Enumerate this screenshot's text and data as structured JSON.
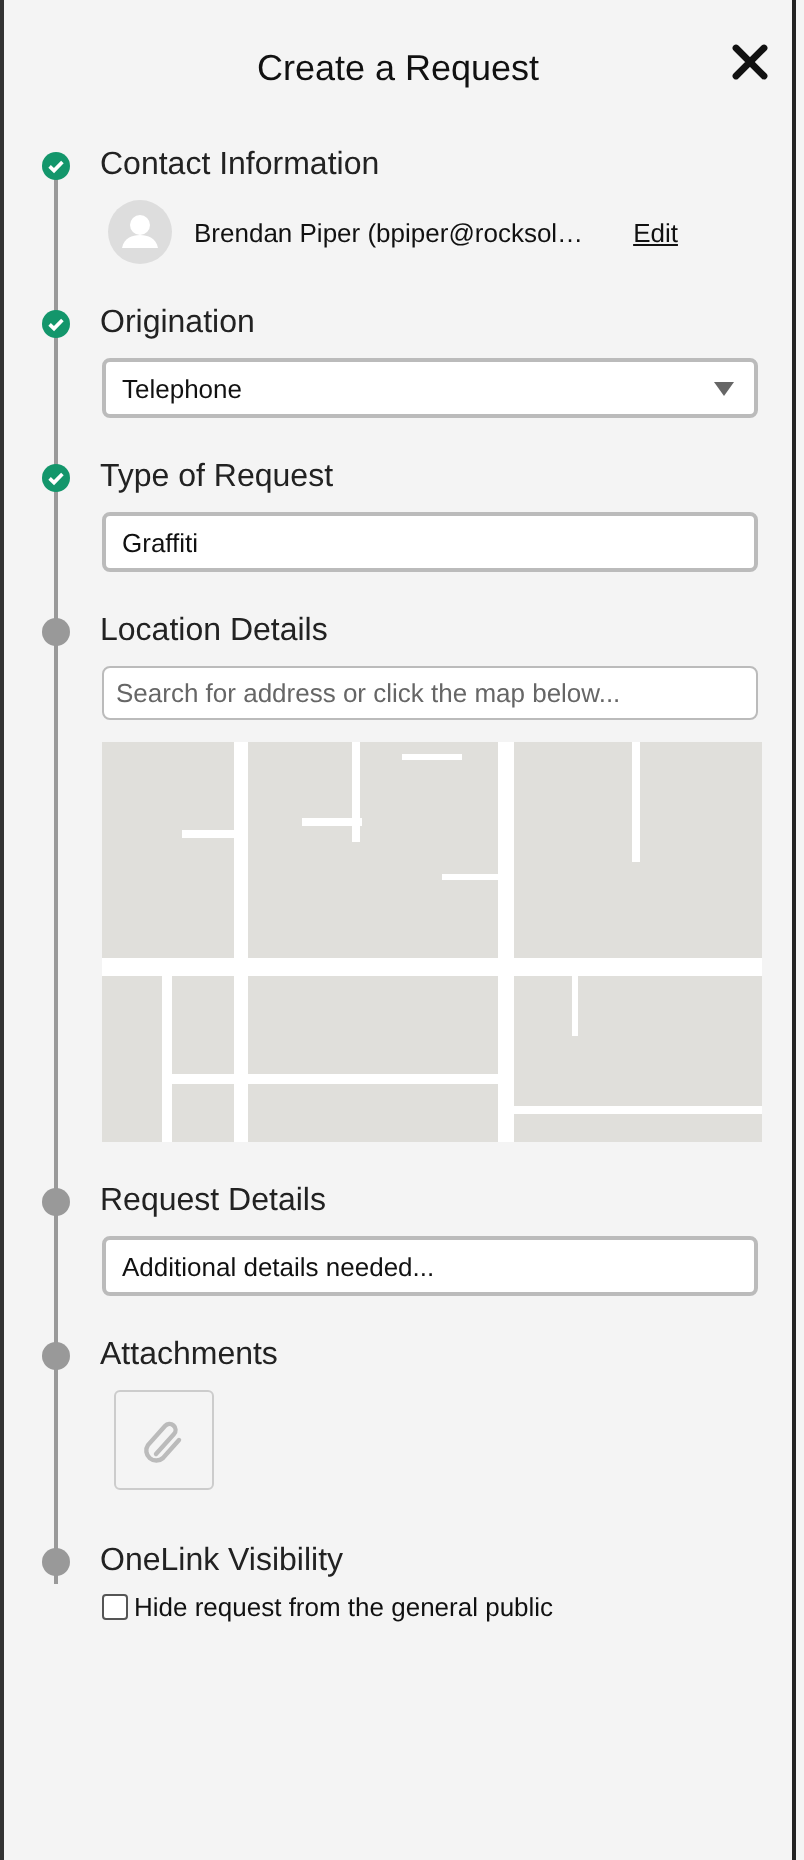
{
  "title": "Create a Request",
  "steps": [
    {
      "kind": "contact",
      "label": "Contact Information",
      "completed": true,
      "name": "Brendan Piper (bpiper@rocksol…",
      "action": "Edit"
    },
    {
      "kind": "select",
      "label": "Origination",
      "completed": true,
      "value": "Telephone"
    },
    {
      "kind": "text",
      "label": "Type of Request",
      "completed": true,
      "value": "Graffiti"
    },
    {
      "kind": "location",
      "label": "Location Details",
      "completed": false,
      "placeholder": "Search for address or click the map below..."
    },
    {
      "kind": "text",
      "label": "Request Details",
      "completed": false,
      "value": "Additional details needed..."
    },
    {
      "kind": "attachments",
      "label": "Attachments",
      "completed": false
    },
    {
      "kind": "checkbox",
      "label": "OneLink Visibility",
      "completed": false,
      "option": "Hide request from the general public",
      "checked": false
    }
  ]
}
